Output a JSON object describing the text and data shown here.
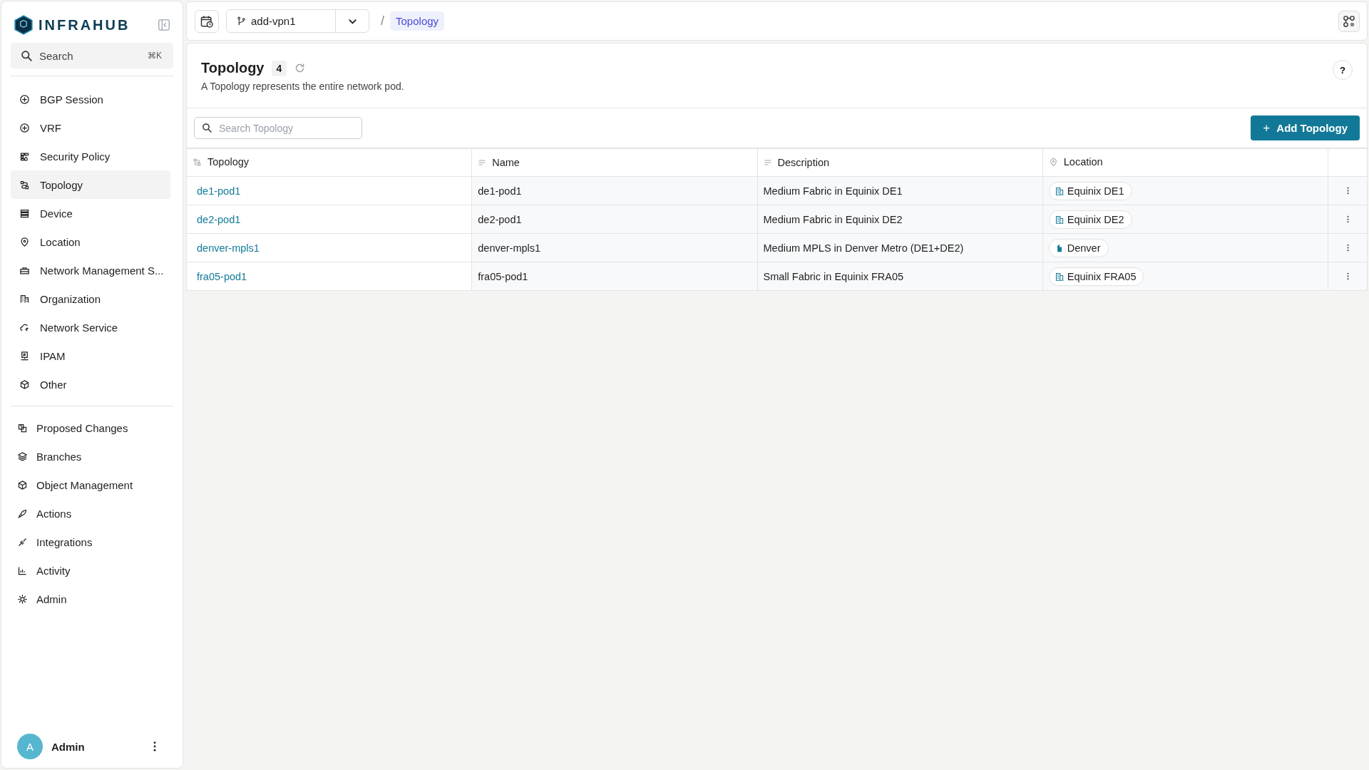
{
  "brand": {
    "name": "INFRAHUB"
  },
  "sidebar": {
    "search": {
      "placeholder": "Search",
      "shortcut": "⌘K"
    },
    "items": [
      {
        "label": "BGP Session",
        "selected": false
      },
      {
        "label": "VRF",
        "selected": false
      },
      {
        "label": "Security Policy",
        "selected": false
      },
      {
        "label": "Topology",
        "selected": true
      },
      {
        "label": "Device",
        "selected": false
      },
      {
        "label": "Location",
        "selected": false
      },
      {
        "label": "Network Management S...",
        "selected": false
      },
      {
        "label": "Organization",
        "selected": false
      },
      {
        "label": "Network Service",
        "selected": false
      },
      {
        "label": "IPAM",
        "selected": false
      },
      {
        "label": "Other",
        "selected": false
      }
    ],
    "secondary_items": [
      {
        "label": "Proposed Changes"
      },
      {
        "label": "Branches"
      },
      {
        "label": "Object Management"
      },
      {
        "label": "Actions"
      },
      {
        "label": "Integrations"
      },
      {
        "label": "Activity"
      },
      {
        "label": "Admin"
      }
    ],
    "user": {
      "initial": "A",
      "name": "Admin"
    }
  },
  "top_bar": {
    "branch": "add-vpn1",
    "breadcrumb_separator": "/",
    "breadcrumb": "Topology"
  },
  "header": {
    "title": "Topology",
    "count": "4",
    "description": "A Topology represents the entire network pod.",
    "help": "?"
  },
  "toolbar": {
    "search": {
      "placeholder": "Search Topology"
    },
    "add_button": "+ Add Topology"
  },
  "table": {
    "columns": [
      {
        "label": "Topology"
      },
      {
        "label": "Name"
      },
      {
        "label": "Description"
      },
      {
        "label": "Location"
      }
    ],
    "rows": [
      {
        "topology": "de1-pod1",
        "name": "de1-pod1",
        "description": "Medium Fabric in Equinix DE1",
        "location": {
          "label": "Equinix DE1",
          "kind": "site"
        }
      },
      {
        "topology": "de2-pod1",
        "name": "de2-pod1",
        "description": "Medium Fabric in Equinix DE2",
        "location": {
          "label": "Equinix DE2",
          "kind": "site"
        }
      },
      {
        "topology": "denver-mpls1",
        "name": "denver-mpls1",
        "description": "Medium MPLS in Denver Metro (DE1+DE2)",
        "location": {
          "label": "Denver",
          "kind": "metro"
        }
      },
      {
        "topology": "fra05-pod1",
        "name": "fra05-pod1",
        "description": "Small Fabric in Equinix FRA05",
        "location": {
          "label": "Equinix FRA05",
          "kind": "site"
        }
      }
    ]
  }
}
